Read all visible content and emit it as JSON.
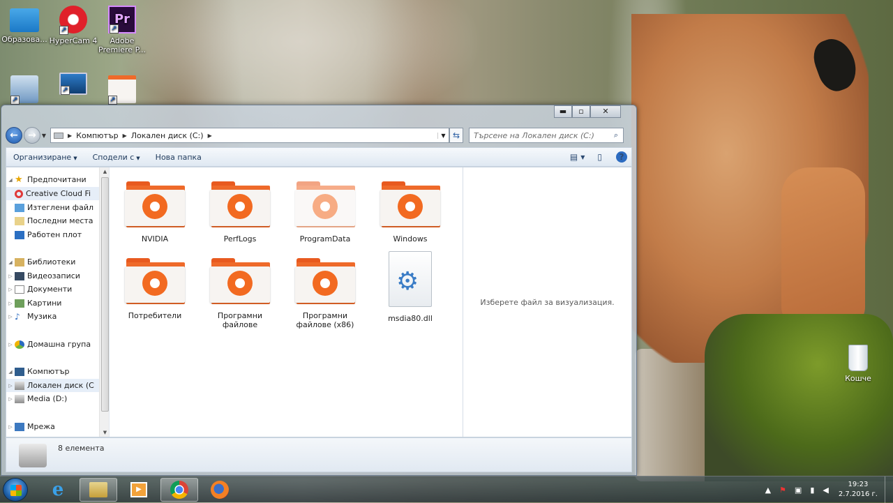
{
  "desktop": {
    "icons": [
      {
        "label": "Образова..."
      },
      {
        "label": "HyperCam 4"
      },
      {
        "label": "Adobe Premiere P..."
      },
      {
        "label": ""
      },
      {
        "label": ""
      },
      {
        "label": ""
      }
    ],
    "recycle_bin": "Кошче"
  },
  "explorer": {
    "caption": {
      "minimize": "▬",
      "maximize": "▫",
      "close": "✕"
    },
    "address": {
      "crumbs": [
        "Компютър",
        "Локален диск (C:)"
      ]
    },
    "search_placeholder": "Търсене на Локален диск (C:)",
    "toolbar": {
      "organize": "Организиране",
      "share": "Сподели с",
      "new_folder": "Нова папка"
    },
    "nav": {
      "favorites": "Предпочитани",
      "favorites_items": [
        "Creative Cloud Fi",
        "Изтеглени файл",
        "Последни места",
        "Работен плот"
      ],
      "libraries": "Библиотеки",
      "libraries_items": [
        "Видеозаписи",
        "Документи",
        "Картини",
        "Музика"
      ],
      "homegroup": "Домашна група",
      "computer": "Компютър",
      "computer_items": [
        "Локален диск (C",
        "Media (D:)"
      ],
      "network": "Мрежа"
    },
    "files": [
      {
        "name": "NVIDIA",
        "type": "folder"
      },
      {
        "name": "PerfLogs",
        "type": "folder"
      },
      {
        "name": "ProgramData",
        "type": "folder"
      },
      {
        "name": "Windows",
        "type": "folder"
      },
      {
        "name": "Потребители",
        "type": "folder"
      },
      {
        "name": "Програмни файлове",
        "type": "folder"
      },
      {
        "name": "Програмни файлове (x86)",
        "type": "folder"
      },
      {
        "name": "msdia80.dll",
        "type": "file"
      }
    ],
    "preview_text": "Изберете файл за визуализация.",
    "status": "8 елемента"
  },
  "taskbar": {
    "clock_time": "19:23",
    "clock_date": "2.7.2016 г."
  }
}
